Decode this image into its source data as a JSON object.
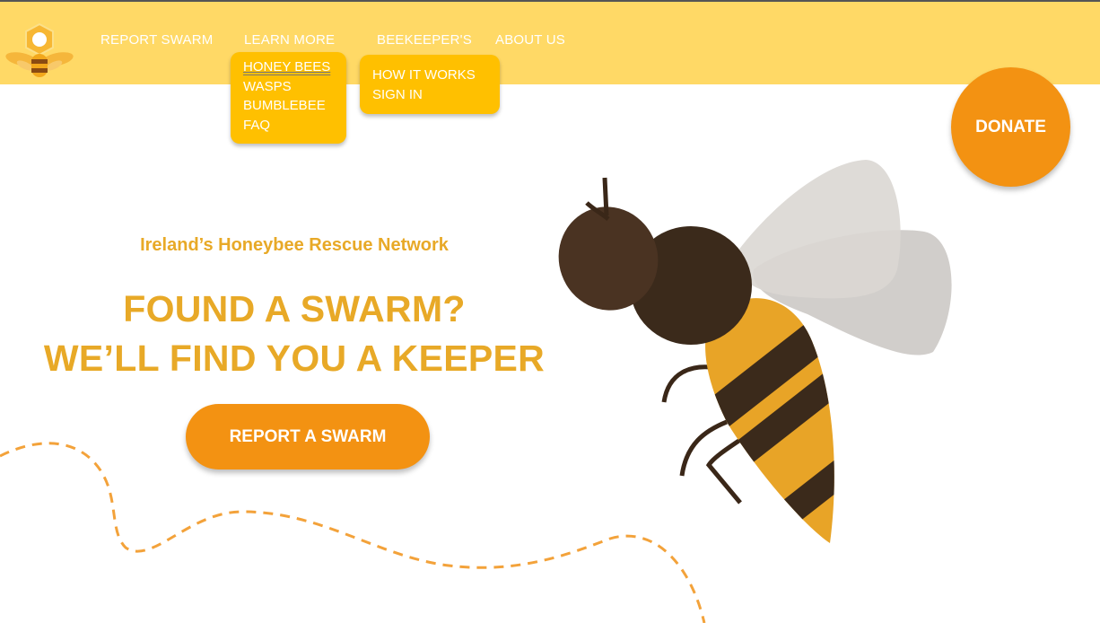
{
  "nav": {
    "links": [
      "REPORT SWARM",
      "LEARN MORE",
      "BEEKEEPER'S",
      "ABOUT US"
    ],
    "learn_more_menu": [
      "HONEY BEES",
      "WASPS",
      "BUMBLEBEE",
      "FAQ"
    ],
    "beekeepers_menu": [
      "HOW IT WORKS",
      "SIGN IN"
    ]
  },
  "donate_label": "DONATE",
  "hero": {
    "tagline": "Ireland’s Honeybee Rescue Network",
    "headline_line1": "FOUND A SWARM?",
    "headline_line2": "WE’LL FIND YOU A KEEPER",
    "cta_label": "REPORT A SWARM"
  },
  "colors": {
    "navbar": "#ffd966",
    "dropdown": "#ffc000",
    "accent_orange": "#f39212",
    "headline_gold": "#e8a927"
  },
  "icons": [
    "bee-logo-icon",
    "bee-illustration"
  ]
}
